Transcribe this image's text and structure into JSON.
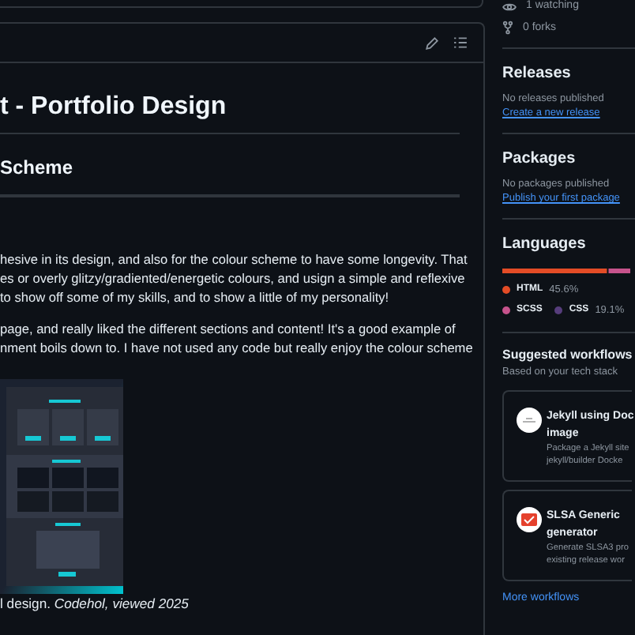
{
  "readme": {
    "title": "t - Portfolio Design",
    "subheading": "Scheme",
    "paragraphs": [
      [
        "hesive in its design, and also for the colour scheme to have some longevity. That",
        "es or overly glitzy/gradiented/energetic colours, and usign a simple and reflexive",
        "to show off some of my skills, and to show a little of my personality!"
      ],
      [
        "page, and really liked the different sections and content! It's a good example of",
        "nment boils down to. I have not used any code but really enjoy the colour scheme"
      ]
    ],
    "caption": "l design. *Codehol, viewed 2025*"
  },
  "sidebar": {
    "stats": [
      {
        "kind": "watching",
        "text": "1 watching"
      },
      {
        "kind": "forks",
        "text": "0 forks"
      }
    ],
    "releases": {
      "title": "Releases",
      "note": "No releases published",
      "link": "Create a new release"
    },
    "packages": {
      "title": "Packages",
      "note": "No packages published",
      "link": "Publish your first package"
    },
    "languages": {
      "title": "Languages",
      "items": [
        {
          "name": "HTML",
          "percent": "45.6%",
          "color": "#e34c26",
          "level": 0.82
        },
        {
          "name": "SCSS",
          "color": "#c6538c",
          "level": 0.18
        },
        {
          "name": "CSS",
          "percent": "19.1%",
          "color": "#563d7c"
        }
      ]
    },
    "workflows": {
      "title": "Suggested workflows",
      "subtitle": "Based on your tech stack",
      "cards": [
        {
          "kind": "jekyll",
          "title": [
            "Jekyll using Doc",
            "image"
          ],
          "description": [
            "Package a Jekyll site",
            "jekyll/builder Docke"
          ]
        },
        {
          "kind": "slsa",
          "title": [
            "SLSA Generic",
            "generator"
          ],
          "description": [
            "Generate SLSA3 pro",
            "existing release wor"
          ]
        }
      ],
      "more": "More workflows"
    }
  }
}
